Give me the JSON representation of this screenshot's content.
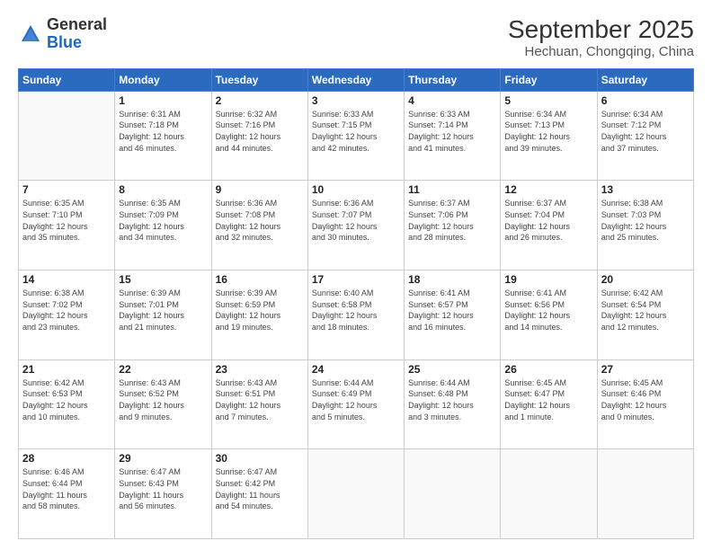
{
  "header": {
    "logo_line1": "General",
    "logo_line2": "Blue",
    "month_year": "September 2025",
    "location": "Hechuan, Chongqing, China"
  },
  "days_of_week": [
    "Sunday",
    "Monday",
    "Tuesday",
    "Wednesday",
    "Thursday",
    "Friday",
    "Saturday"
  ],
  "weeks": [
    [
      {
        "day": "",
        "info": ""
      },
      {
        "day": "1",
        "info": "Sunrise: 6:31 AM\nSunset: 7:18 PM\nDaylight: 12 hours\nand 46 minutes."
      },
      {
        "day": "2",
        "info": "Sunrise: 6:32 AM\nSunset: 7:16 PM\nDaylight: 12 hours\nand 44 minutes."
      },
      {
        "day": "3",
        "info": "Sunrise: 6:33 AM\nSunset: 7:15 PM\nDaylight: 12 hours\nand 42 minutes."
      },
      {
        "day": "4",
        "info": "Sunrise: 6:33 AM\nSunset: 7:14 PM\nDaylight: 12 hours\nand 41 minutes."
      },
      {
        "day": "5",
        "info": "Sunrise: 6:34 AM\nSunset: 7:13 PM\nDaylight: 12 hours\nand 39 minutes."
      },
      {
        "day": "6",
        "info": "Sunrise: 6:34 AM\nSunset: 7:12 PM\nDaylight: 12 hours\nand 37 minutes."
      }
    ],
    [
      {
        "day": "7",
        "info": "Sunrise: 6:35 AM\nSunset: 7:10 PM\nDaylight: 12 hours\nand 35 minutes."
      },
      {
        "day": "8",
        "info": "Sunrise: 6:35 AM\nSunset: 7:09 PM\nDaylight: 12 hours\nand 34 minutes."
      },
      {
        "day": "9",
        "info": "Sunrise: 6:36 AM\nSunset: 7:08 PM\nDaylight: 12 hours\nand 32 minutes."
      },
      {
        "day": "10",
        "info": "Sunrise: 6:36 AM\nSunset: 7:07 PM\nDaylight: 12 hours\nand 30 minutes."
      },
      {
        "day": "11",
        "info": "Sunrise: 6:37 AM\nSunset: 7:06 PM\nDaylight: 12 hours\nand 28 minutes."
      },
      {
        "day": "12",
        "info": "Sunrise: 6:37 AM\nSunset: 7:04 PM\nDaylight: 12 hours\nand 26 minutes."
      },
      {
        "day": "13",
        "info": "Sunrise: 6:38 AM\nSunset: 7:03 PM\nDaylight: 12 hours\nand 25 minutes."
      }
    ],
    [
      {
        "day": "14",
        "info": "Sunrise: 6:38 AM\nSunset: 7:02 PM\nDaylight: 12 hours\nand 23 minutes."
      },
      {
        "day": "15",
        "info": "Sunrise: 6:39 AM\nSunset: 7:01 PM\nDaylight: 12 hours\nand 21 minutes."
      },
      {
        "day": "16",
        "info": "Sunrise: 6:39 AM\nSunset: 6:59 PM\nDaylight: 12 hours\nand 19 minutes."
      },
      {
        "day": "17",
        "info": "Sunrise: 6:40 AM\nSunset: 6:58 PM\nDaylight: 12 hours\nand 18 minutes."
      },
      {
        "day": "18",
        "info": "Sunrise: 6:41 AM\nSunset: 6:57 PM\nDaylight: 12 hours\nand 16 minutes."
      },
      {
        "day": "19",
        "info": "Sunrise: 6:41 AM\nSunset: 6:56 PM\nDaylight: 12 hours\nand 14 minutes."
      },
      {
        "day": "20",
        "info": "Sunrise: 6:42 AM\nSunset: 6:54 PM\nDaylight: 12 hours\nand 12 minutes."
      }
    ],
    [
      {
        "day": "21",
        "info": "Sunrise: 6:42 AM\nSunset: 6:53 PM\nDaylight: 12 hours\nand 10 minutes."
      },
      {
        "day": "22",
        "info": "Sunrise: 6:43 AM\nSunset: 6:52 PM\nDaylight: 12 hours\nand 9 minutes."
      },
      {
        "day": "23",
        "info": "Sunrise: 6:43 AM\nSunset: 6:51 PM\nDaylight: 12 hours\nand 7 minutes."
      },
      {
        "day": "24",
        "info": "Sunrise: 6:44 AM\nSunset: 6:49 PM\nDaylight: 12 hours\nand 5 minutes."
      },
      {
        "day": "25",
        "info": "Sunrise: 6:44 AM\nSunset: 6:48 PM\nDaylight: 12 hours\nand 3 minutes."
      },
      {
        "day": "26",
        "info": "Sunrise: 6:45 AM\nSunset: 6:47 PM\nDaylight: 12 hours\nand 1 minute."
      },
      {
        "day": "27",
        "info": "Sunrise: 6:45 AM\nSunset: 6:46 PM\nDaylight: 12 hours\nand 0 minutes."
      }
    ],
    [
      {
        "day": "28",
        "info": "Sunrise: 6:46 AM\nSunset: 6:44 PM\nDaylight: 11 hours\nand 58 minutes."
      },
      {
        "day": "29",
        "info": "Sunrise: 6:47 AM\nSunset: 6:43 PM\nDaylight: 11 hours\nand 56 minutes."
      },
      {
        "day": "30",
        "info": "Sunrise: 6:47 AM\nSunset: 6:42 PM\nDaylight: 11 hours\nand 54 minutes."
      },
      {
        "day": "",
        "info": ""
      },
      {
        "day": "",
        "info": ""
      },
      {
        "day": "",
        "info": ""
      },
      {
        "day": "",
        "info": ""
      }
    ]
  ]
}
